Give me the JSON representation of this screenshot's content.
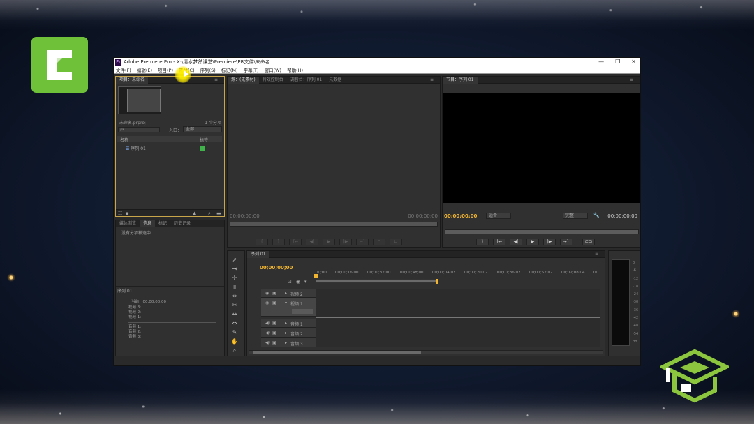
{
  "window": {
    "title": "Adobe Premiere Pro - X:\\清水梦然课堂\\Premiere\\PR文件\\未命名",
    "controls": [
      "—",
      "❐",
      "✕"
    ]
  },
  "menu": [
    "文件(F)",
    "编辑(E)",
    "项目(P)",
    "素材(C)",
    "序列(S)",
    "标记(M)",
    "字幕(T)",
    "窗口(W)",
    "帮助(H)"
  ],
  "project_panel": {
    "tab": "项目：未命名",
    "file_name": "未命名.prproj",
    "item_count": "1 个分项",
    "search_placeholder": "ρ▾",
    "in_label": "入口：",
    "in_value": "全部",
    "col_name": "名称",
    "col_label": "标签",
    "item": "序列 01"
  },
  "source_panel": {
    "tabs": [
      "源：(无素材)",
      "特效控制台",
      "调音台：序列 01",
      "元数据"
    ],
    "tc_left": "00;00;00;00",
    "tc_right": "00;00;00;00"
  },
  "program_panel": {
    "tab": "节目：序列 01",
    "tc_left": "00;00;00;00",
    "tc_right": "00;00;00;00",
    "fit": "适合",
    "quality": "完整"
  },
  "info_panel": {
    "tabs": [
      "媒体浏览",
      "信息",
      "标记",
      "历史记录"
    ],
    "empty_text": "没有分项被选中",
    "sequence": "序列 01",
    "current": "当前：00;00;00;00",
    "video_lines": [
      "视频 3:",
      "视频 2:",
      "视频 1:"
    ],
    "audio_lines": [
      "音频 1:",
      "音频 2:",
      "音频 3:"
    ]
  },
  "timeline": {
    "tab": "序列 01",
    "timecode": "00;00;00;00",
    "ruler": [
      "00;00",
      "00;00;16;00",
      "00;00;32;00",
      "00;00;48;00",
      "00;01;04;02",
      "00;01;20;02",
      "00;01;36;02",
      "00;01;52;02",
      "00;02;08;04",
      "00"
    ],
    "video_tracks": [
      "视频 2",
      "视频 1"
    ],
    "audio_tracks": [
      "音频 1",
      "音频 2",
      "音频 3"
    ]
  },
  "meter": {
    "scale": [
      "0",
      "-6",
      "-12",
      "-18",
      "-24",
      "-30",
      "-36",
      "-42",
      "-48",
      "-54",
      "dB"
    ]
  },
  "colors": {
    "accent_timecode": "#f1b531",
    "camtasia_green": "#6fc13a",
    "label_green": "#3fb34a"
  }
}
